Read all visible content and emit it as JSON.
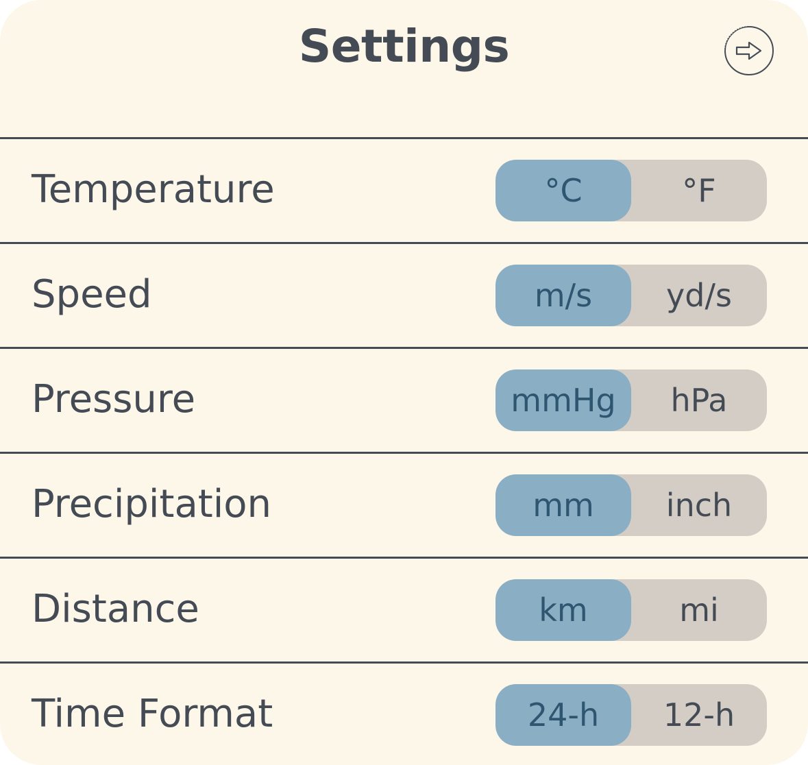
{
  "header": {
    "title": "Settings",
    "exit_icon": "exit-arrow-icon"
  },
  "colors": {
    "background": "#fdf7ea",
    "text": "#454b54",
    "toggle_track": "#d3cdc6",
    "toggle_active": "#8aaec4",
    "toggle_active_text": "#2f5670"
  },
  "settings": [
    {
      "label": "Temperature",
      "options": [
        "°C",
        "°F"
      ],
      "selected": "°C"
    },
    {
      "label": "Speed",
      "options": [
        "m/s",
        "yd/s"
      ],
      "selected": "m/s"
    },
    {
      "label": "Pressure",
      "options": [
        "mmHg",
        "hPa"
      ],
      "selected": "mmHg"
    },
    {
      "label": "Precipitation",
      "options": [
        "mm",
        "inch"
      ],
      "selected": "mm"
    },
    {
      "label": "Distance",
      "options": [
        "km",
        "mi"
      ],
      "selected": "km"
    },
    {
      "label": "Time Format",
      "options": [
        "24-h",
        "12-h"
      ],
      "selected": "24-h"
    }
  ]
}
